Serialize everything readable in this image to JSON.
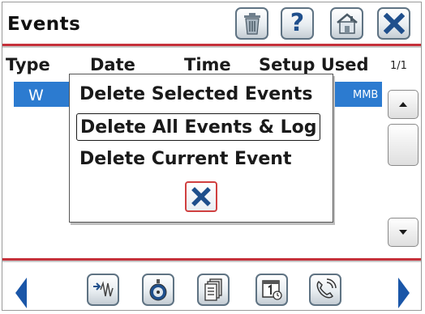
{
  "header": {
    "title": "Events",
    "buttons": [
      {
        "icon": "trash-icon"
      },
      {
        "icon": "help-icon",
        "glyph": "?"
      },
      {
        "icon": "home-icon"
      },
      {
        "icon": "close-icon"
      }
    ]
  },
  "table": {
    "columns": [
      "Type",
      "Date",
      "Time",
      "Setup Used"
    ],
    "page_indicator": "1/1",
    "selected_row": {
      "type": "W",
      "setup_used_visible": "MMB"
    }
  },
  "popup": {
    "items": [
      {
        "label": "Delete Selected Events"
      },
      {
        "label": "Delete All Events & Log",
        "focused": true
      },
      {
        "label": "Delete Current Event"
      }
    ],
    "close_icon": "close-icon"
  },
  "footer": {
    "buttons": [
      "waveform-icon",
      "meter-icon",
      "documents-icon",
      "calendar-icon",
      "phone-icon"
    ],
    "nav": [
      "previous-arrow-icon",
      "next-arrow-icon"
    ]
  },
  "colors": {
    "accent_red": "#c5303a",
    "selection_blue": "#2c7bd0",
    "nav_blue": "#1a56a8",
    "close_x_blue": "#1f4f8c",
    "close_border_red": "#d04040"
  }
}
